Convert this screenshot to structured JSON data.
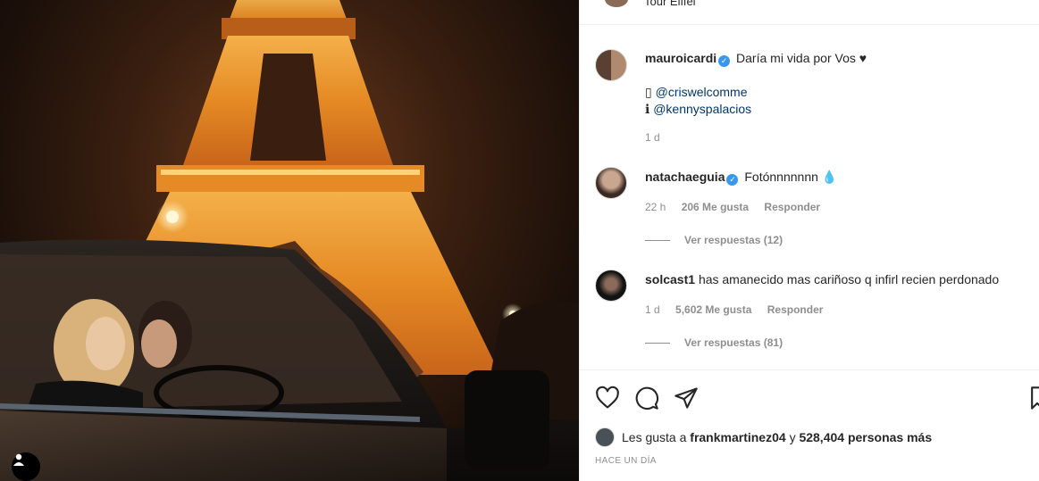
{
  "post": {
    "location": "Tour Eiffel"
  },
  "caption": {
    "username": "mauroicardi",
    "text": "Daría mi vida por Vos ♥",
    "credit_1_icon": "▯",
    "credit_1_mention": "@criswelcomme",
    "credit_2_icon": "ℹ",
    "credit_2_mention": "@kennyspalacios",
    "time": "1 d"
  },
  "comments": [
    {
      "username": "natachaeguia",
      "text": "Fotónnnnnnn 💧",
      "time": "22 h",
      "likes": "206 Me gusta",
      "reply": "Responder",
      "view_replies": "Ver respuestas (12)"
    },
    {
      "username": "solcast1",
      "text": "has amanecido mas cariñoso q infirl recien perdonado",
      "time": "1 d",
      "likes": "5,602 Me gusta",
      "reply": "Responder",
      "view_replies": "Ver respuestas (81)"
    }
  ],
  "likes_summary": {
    "prefix": "Les gusta a",
    "user": "frankmartinez04",
    "joiner": "y",
    "count": "528,404 personas más"
  },
  "posted": "HACE UN DÍA",
  "icons": {
    "like": "heart-icon",
    "comment": "comment-icon",
    "share": "paper-plane-icon",
    "save": "bookmark-icon",
    "tag": "user-tag-icon",
    "verified": "verified-badge-icon"
  },
  "colors": {
    "verified": "#3897f0",
    "mention": "#00376b",
    "muted": "#8e8e8e"
  }
}
